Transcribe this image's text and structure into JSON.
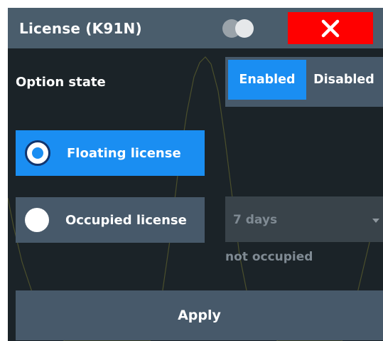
{
  "dialog": {
    "title": "License (K91N)",
    "toggle_icon": "theme-toggle-icon",
    "close_icon": "close-icon",
    "colors": {
      "title_bar": "#4a5d6c",
      "accent": "#1a8ef2",
      "close": "#ff0000",
      "background": "#1b2328"
    }
  },
  "option_state": {
    "label": "Option state",
    "options": [
      "Enabled",
      "Disabled"
    ],
    "selected": "Enabled"
  },
  "license_type": {
    "options": [
      {
        "label": "Floating license",
        "selected": true
      },
      {
        "label": "Occupied license",
        "selected": false
      }
    ]
  },
  "occupied_duration": {
    "value": "7 days",
    "icon": "dropdown-arrow-icon"
  },
  "occupation_status": "not occupied",
  "apply_label": "Apply"
}
